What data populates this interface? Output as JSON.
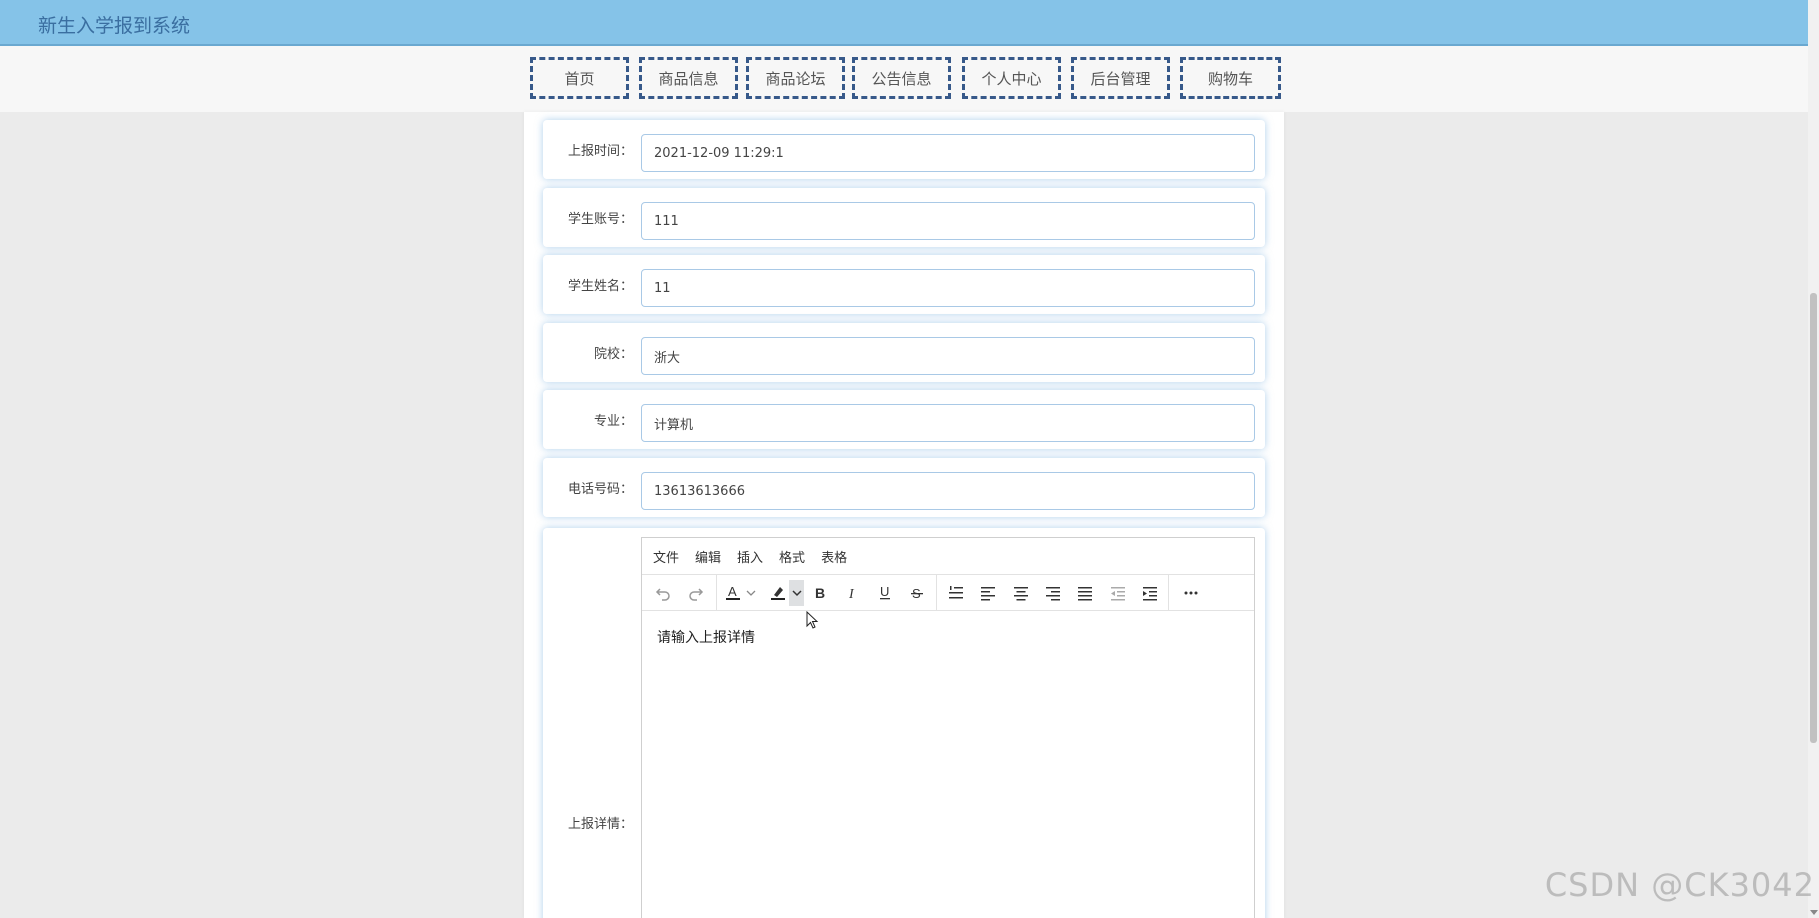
{
  "app": {
    "title": "新生入学报到系统"
  },
  "nav": {
    "items": [
      {
        "label": "首页"
      },
      {
        "label": "商品信息"
      },
      {
        "label": "商品论坛"
      },
      {
        "label": "公告信息"
      },
      {
        "label": "个人中心"
      },
      {
        "label": "后台管理"
      },
      {
        "label": "购物车"
      }
    ]
  },
  "form": {
    "fields": [
      {
        "label": "上报时间：",
        "value": "2021-12-09 11:29:1"
      },
      {
        "label": "学生账号：",
        "value": "111"
      },
      {
        "label": "学生姓名：",
        "value": "11"
      },
      {
        "label": "院校：",
        "value": "浙大"
      },
      {
        "label": "专业：",
        "value": "计算机"
      },
      {
        "label": "电话号码：",
        "value": "13613613666"
      }
    ],
    "details": {
      "label": "上报详情：",
      "placeholder": "请输入上报详情"
    }
  },
  "editor": {
    "menu": [
      {
        "label": "文件"
      },
      {
        "label": "编辑"
      },
      {
        "label": "插入"
      },
      {
        "label": "格式"
      },
      {
        "label": "表格"
      }
    ],
    "toolbar_icons": [
      "undo-icon",
      "redo-icon",
      "text-color-icon",
      "highlight-icon",
      "bold-icon",
      "italic-icon",
      "underline-icon",
      "strikethrough-icon",
      "ordered-list-icon",
      "align-left-icon",
      "align-center-icon",
      "align-right-icon",
      "justify-icon",
      "outdent-icon",
      "indent-icon",
      "more-icon"
    ]
  },
  "watermark": "CSDN @CK3042"
}
